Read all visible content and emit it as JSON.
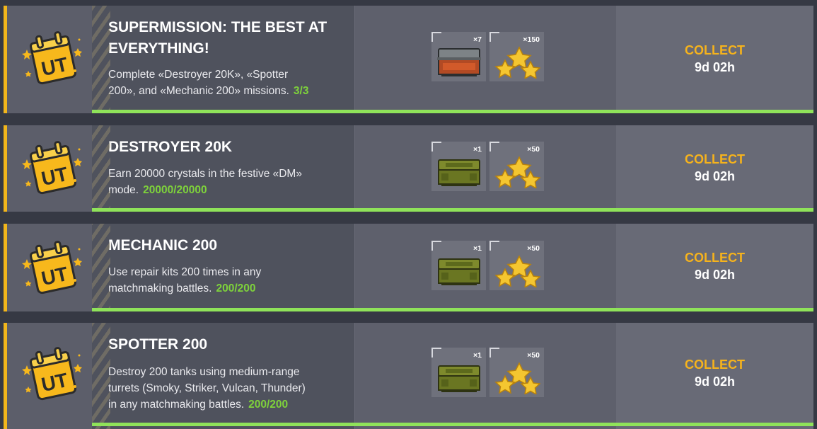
{
  "colors": {
    "accent": "#f2b61c",
    "progress": "#7ed23b",
    "collect": "#f6b31c",
    "bar": "#8fe35a"
  },
  "missions": [
    {
      "icon": "ut-calendar-badge-icon",
      "title_line1": "SUPERMISSION: THE BEST AT",
      "title_line2": "EVERYTHING!",
      "desc_line1": "Complete «Destroyer 20K», «Spotter",
      "desc_line2": "200», and «Mechanic 200» missions.",
      "progress": "3/3",
      "rewards": [
        {
          "icon": "container-icon",
          "qty": "×7"
        },
        {
          "icon": "stars-icon",
          "qty": "×150"
        }
      ],
      "collect": "COLLECT",
      "timer": "9d 02h"
    },
    {
      "icon": "ut-calendar-badge-icon",
      "title_line1": "DESTROYER 20K",
      "desc_line1": "Earn 20000 crystals in the festive «DM»",
      "desc_line2": "mode.",
      "progress": "20000/20000",
      "rewards": [
        {
          "icon": "supply-box-icon",
          "qty": "×1"
        },
        {
          "icon": "stars-icon",
          "qty": "×50"
        }
      ],
      "collect": "COLLECT",
      "timer": "9d 02h"
    },
    {
      "icon": "ut-calendar-badge-icon",
      "title_line1": "MECHANIC 200",
      "desc_line1": "Use repair kits 200 times in any",
      "desc_line2": "matchmaking battles.",
      "progress": "200/200",
      "rewards": [
        {
          "icon": "supply-box-icon",
          "qty": "×1"
        },
        {
          "icon": "stars-icon",
          "qty": "×50"
        }
      ],
      "collect": "COLLECT",
      "timer": "9d 02h"
    },
    {
      "icon": "ut-calendar-badge-icon",
      "title_line1": "SPOTTER 200",
      "desc_line1": "Destroy 200 tanks using medium-range",
      "desc_line2": "turrets (Smoky, Striker, Vulcan, Thunder)",
      "desc_line3": "in any matchmaking battles.",
      "progress": "200/200",
      "rewards": [
        {
          "icon": "supply-box-icon",
          "qty": "×1"
        },
        {
          "icon": "stars-icon",
          "qty": "×50"
        }
      ],
      "collect": "COLLECT",
      "timer": "9d 02h"
    }
  ]
}
